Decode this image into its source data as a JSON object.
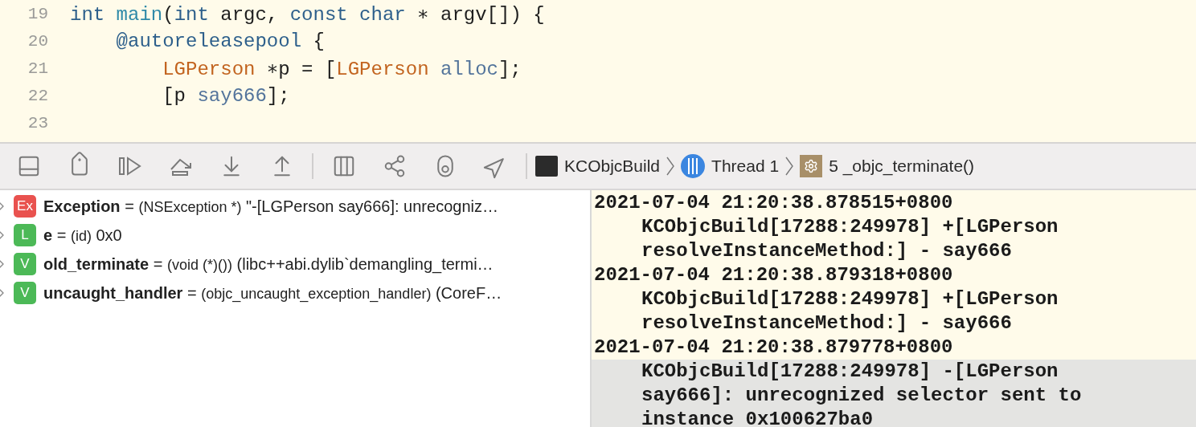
{
  "editor": {
    "lines": [
      {
        "number": "19",
        "tokens": [
          {
            "kind": "keyword",
            "text": "int"
          },
          {
            "kind": "function",
            "text": " main"
          },
          {
            "kind": "plain",
            "text": "("
          },
          {
            "kind": "keyword",
            "text": "int"
          },
          {
            "kind": "plain",
            "text": " argc, "
          },
          {
            "kind": "keyword",
            "text": "const"
          },
          {
            "kind": "keyword",
            "text": " char"
          },
          {
            "kind": "plain",
            "text": " ∗ argv[]) {"
          }
        ]
      },
      {
        "number": "20",
        "tokens": [
          {
            "kind": "keyword",
            "text": "    @autoreleasepool"
          },
          {
            "kind": "plain",
            "text": " {"
          }
        ]
      },
      {
        "number": "21",
        "tokens": [
          {
            "kind": "class",
            "text": "        LGPerson"
          },
          {
            "kind": "plain",
            "text": " ∗p = ["
          },
          {
            "kind": "class",
            "text": "LGPerson"
          },
          {
            "kind": "method",
            "text": " alloc"
          },
          {
            "kind": "plain",
            "text": "];"
          }
        ]
      },
      {
        "number": "22",
        "tokens": [
          {
            "kind": "plain",
            "text": "        [p "
          },
          {
            "kind": "method",
            "text": "say666"
          },
          {
            "kind": "plain",
            "text": "];"
          }
        ]
      },
      {
        "number": "23"
      }
    ]
  },
  "debug_bar": {
    "breadcrumbs": [
      {
        "kind": "process",
        "label": "KCObjcBuild"
      },
      {
        "kind": "thread",
        "label": "Thread 1"
      },
      {
        "kind": "frame",
        "label": "5 _objc_terminate()"
      }
    ]
  },
  "variables": [
    {
      "badge": "Ex",
      "color": "#e9524f",
      "name": "Exception",
      "operator": "=",
      "type": "(NSException *)",
      "value": "\"-[LGPerson say666]: unrecogniz…"
    },
    {
      "badge": "L",
      "color": "#4cb957",
      "name": "e",
      "operator": "=",
      "type": "(id)",
      "value": "0x0"
    },
    {
      "badge": "V",
      "color": "#4cb957",
      "name": "old_terminate",
      "operator": "=",
      "type": "(void (*)())",
      "value": "(libc++abi.dylib`demangling_termi…"
    },
    {
      "badge": "V",
      "color": "#4cb957",
      "name": "uncaught_handler",
      "operator": "=",
      "type": "(objc_uncaught_exception_handler)",
      "value": "(CoreF…"
    }
  ],
  "console": {
    "lines": [
      {
        "text": "2021-07-04 21:20:38.878515+0800",
        "continuation": false,
        "selected": false
      },
      {
        "text": "KCObjcBuild[17288:249978] +[LGPerson",
        "continuation": true,
        "selected": false
      },
      {
        "text": "resolveInstanceMethod:] - say666",
        "continuation": true,
        "selected": false
      },
      {
        "text": "2021-07-04 21:20:38.879318+0800",
        "continuation": false,
        "selected": false
      },
      {
        "text": "KCObjcBuild[17288:249978] +[LGPerson",
        "continuation": true,
        "selected": false
      },
      {
        "text": "resolveInstanceMethod:] - say666",
        "continuation": true,
        "selected": false
      },
      {
        "text": "2021-07-04 21:20:38.879778+0800",
        "continuation": false,
        "selected": false
      },
      {
        "text": "KCObjcBuild[17288:249978] -[LGPerson",
        "continuation": true,
        "selected": true
      },
      {
        "text": "say666]: unrecognized selector sent to",
        "continuation": true,
        "selected": true
      },
      {
        "text": "instance 0x100627ba0",
        "continuation": true,
        "selected": true
      }
    ]
  }
}
